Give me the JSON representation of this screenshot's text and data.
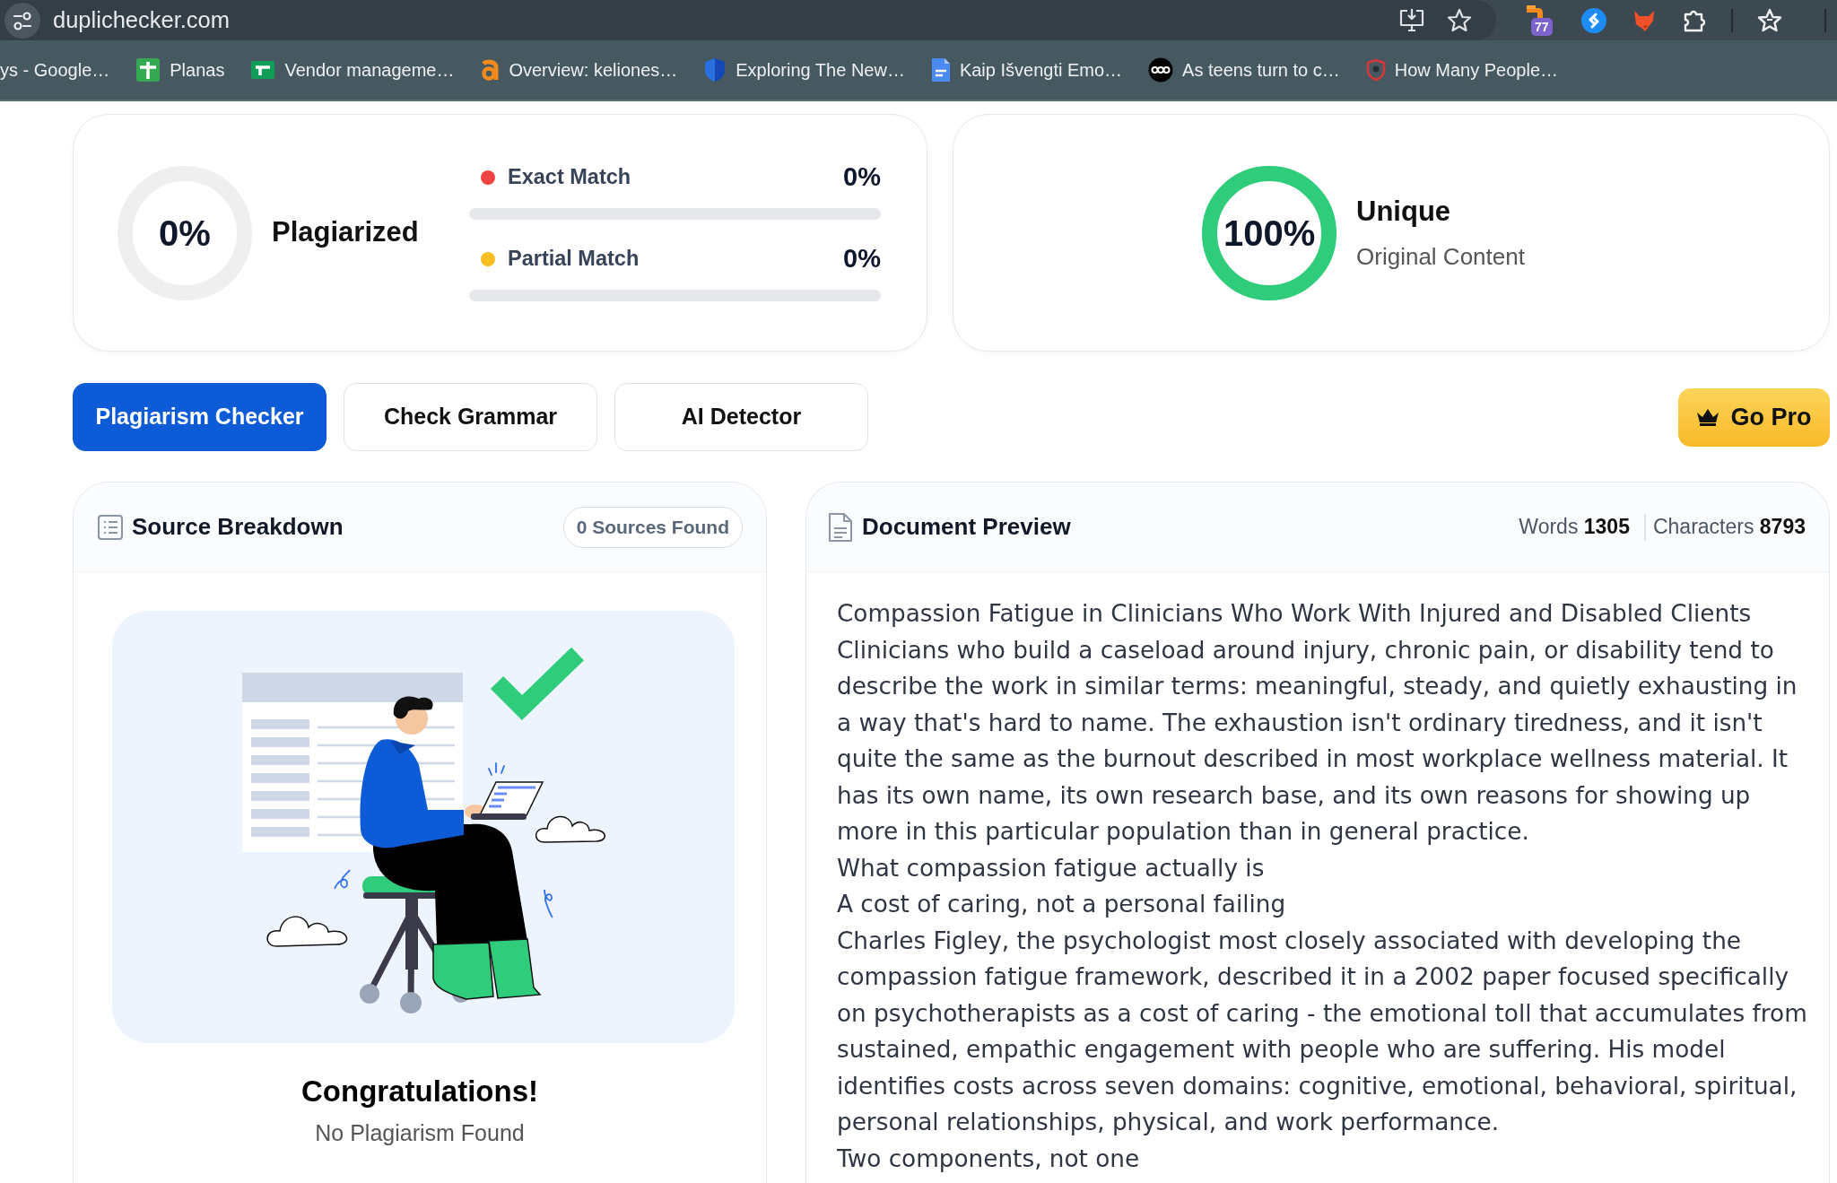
{
  "browser": {
    "address": "duplichecker.com",
    "extension_badge": "77",
    "bookmarks": [
      {
        "label": "ys - Google…"
      },
      {
        "label": "Planas"
      },
      {
        "label": "Vendor manageme…"
      },
      {
        "label": "Overview: keliones…"
      },
      {
        "label": "Exploring The New…"
      },
      {
        "label": "Kaip Išvengti Emo…"
      },
      {
        "label": "As teens turn to c…"
      },
      {
        "label": "How Many People…"
      }
    ]
  },
  "summary": {
    "plagiarized": {
      "percent": "0%",
      "label": "Plagiarized"
    },
    "matches": [
      {
        "label": "Exact Match",
        "percent": "0%",
        "color": "#ef4444",
        "level": 0
      },
      {
        "label": "Partial Match",
        "percent": "0%",
        "color": "#fbbf24",
        "level": 0
      }
    ],
    "unique": {
      "percent": "100%",
      "label": "Unique",
      "sublabel": "Original Content",
      "level": 1
    }
  },
  "tools": [
    {
      "label": "Plagiarism Checker",
      "selected": true
    },
    {
      "label": "Check Grammar",
      "selected": false
    },
    {
      "label": "AI Detector",
      "selected": false
    }
  ],
  "go_pro": {
    "label": "Go Pro"
  },
  "sources": {
    "title": "Source Breakdown",
    "badge": "0 Sources Found",
    "heading": "Congratulations!",
    "message": "No Plagiarism Found"
  },
  "document": {
    "title": "Document Preview",
    "stats": [
      {
        "label": "Words",
        "value": "1305"
      },
      {
        "label": "Characters",
        "value": "8793"
      }
    ],
    "paragraphs": [
      "Compassion Fatigue in Clinicians Who Work With Injured and Disabled Clients",
      "Clinicians who build a caseload around injury, chronic pain, or disability tend to describe the work in similar terms: meaningful, steady, and quietly exhausting in a way that's hard to name. The exhaustion isn't ordinary tiredness, and it isn't quite the same as the burnout described in most workplace wellness material. It has its own name, its own research base, and its own reasons for showing up more in this particular population than in general practice.",
      "What compassion fatigue actually is",
      "A cost of caring, not a personal failing",
      "Charles Figley, the psychologist most closely associated with developing the compassion fatigue framework, described it in a 2002 paper focused specifically on psychotherapists as a cost of caring - the emotional toll that accumulates from sustained, empathic engagement with people who are suffering. His model identifies costs across seven domains: cognitive, emotional, behavioral, spiritual, personal relationships, physical, and work performance.",
      "Two components, not one"
    ]
  }
}
